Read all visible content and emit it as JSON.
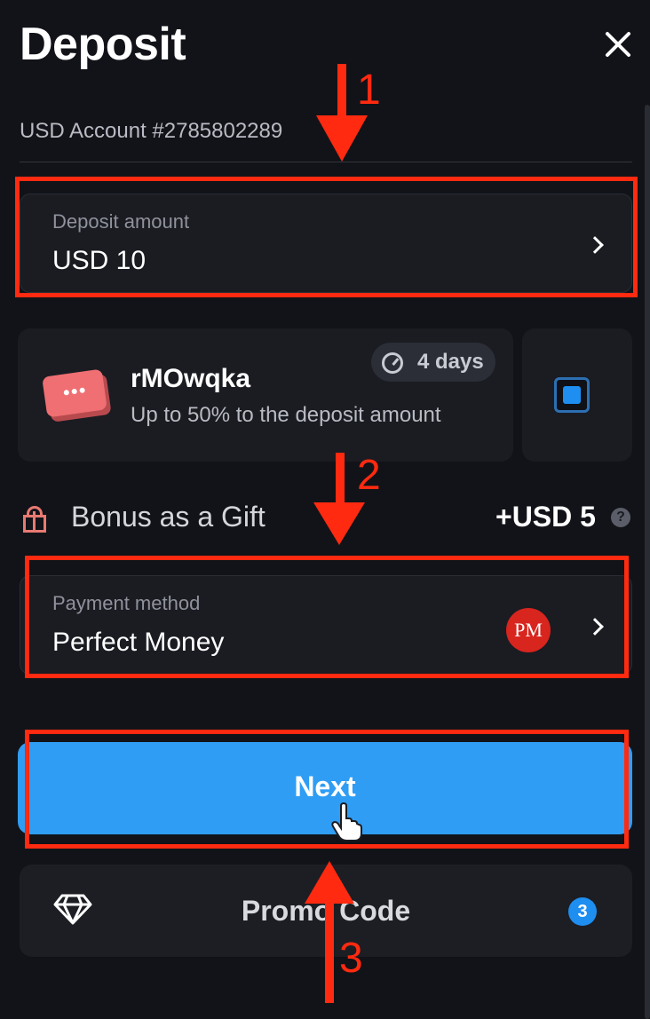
{
  "header": {
    "title": "Deposit"
  },
  "account": {
    "label": "USD Account #2785802289"
  },
  "deposit_amount": {
    "label": "Deposit amount",
    "value": "USD 10"
  },
  "promo": {
    "name": "rMOwqka",
    "description": "Up to 50% to the deposit amount",
    "days_left": "4 days",
    "checked": true
  },
  "bonus": {
    "label": "Bonus as a Gift",
    "value": "+USD 5",
    "help_glyph": "?"
  },
  "payment": {
    "label": "Payment method",
    "value": "Perfect Money",
    "logo_text": "PM"
  },
  "actions": {
    "next_label": "Next",
    "promo_code_label": "Promo Code",
    "promo_code_count": "3"
  },
  "annotations": {
    "step1": "1",
    "step2": "2",
    "step3": "3"
  },
  "colors": {
    "accent": "#2f9df4",
    "annotation": "#ff2a10",
    "background": "#121318"
  }
}
